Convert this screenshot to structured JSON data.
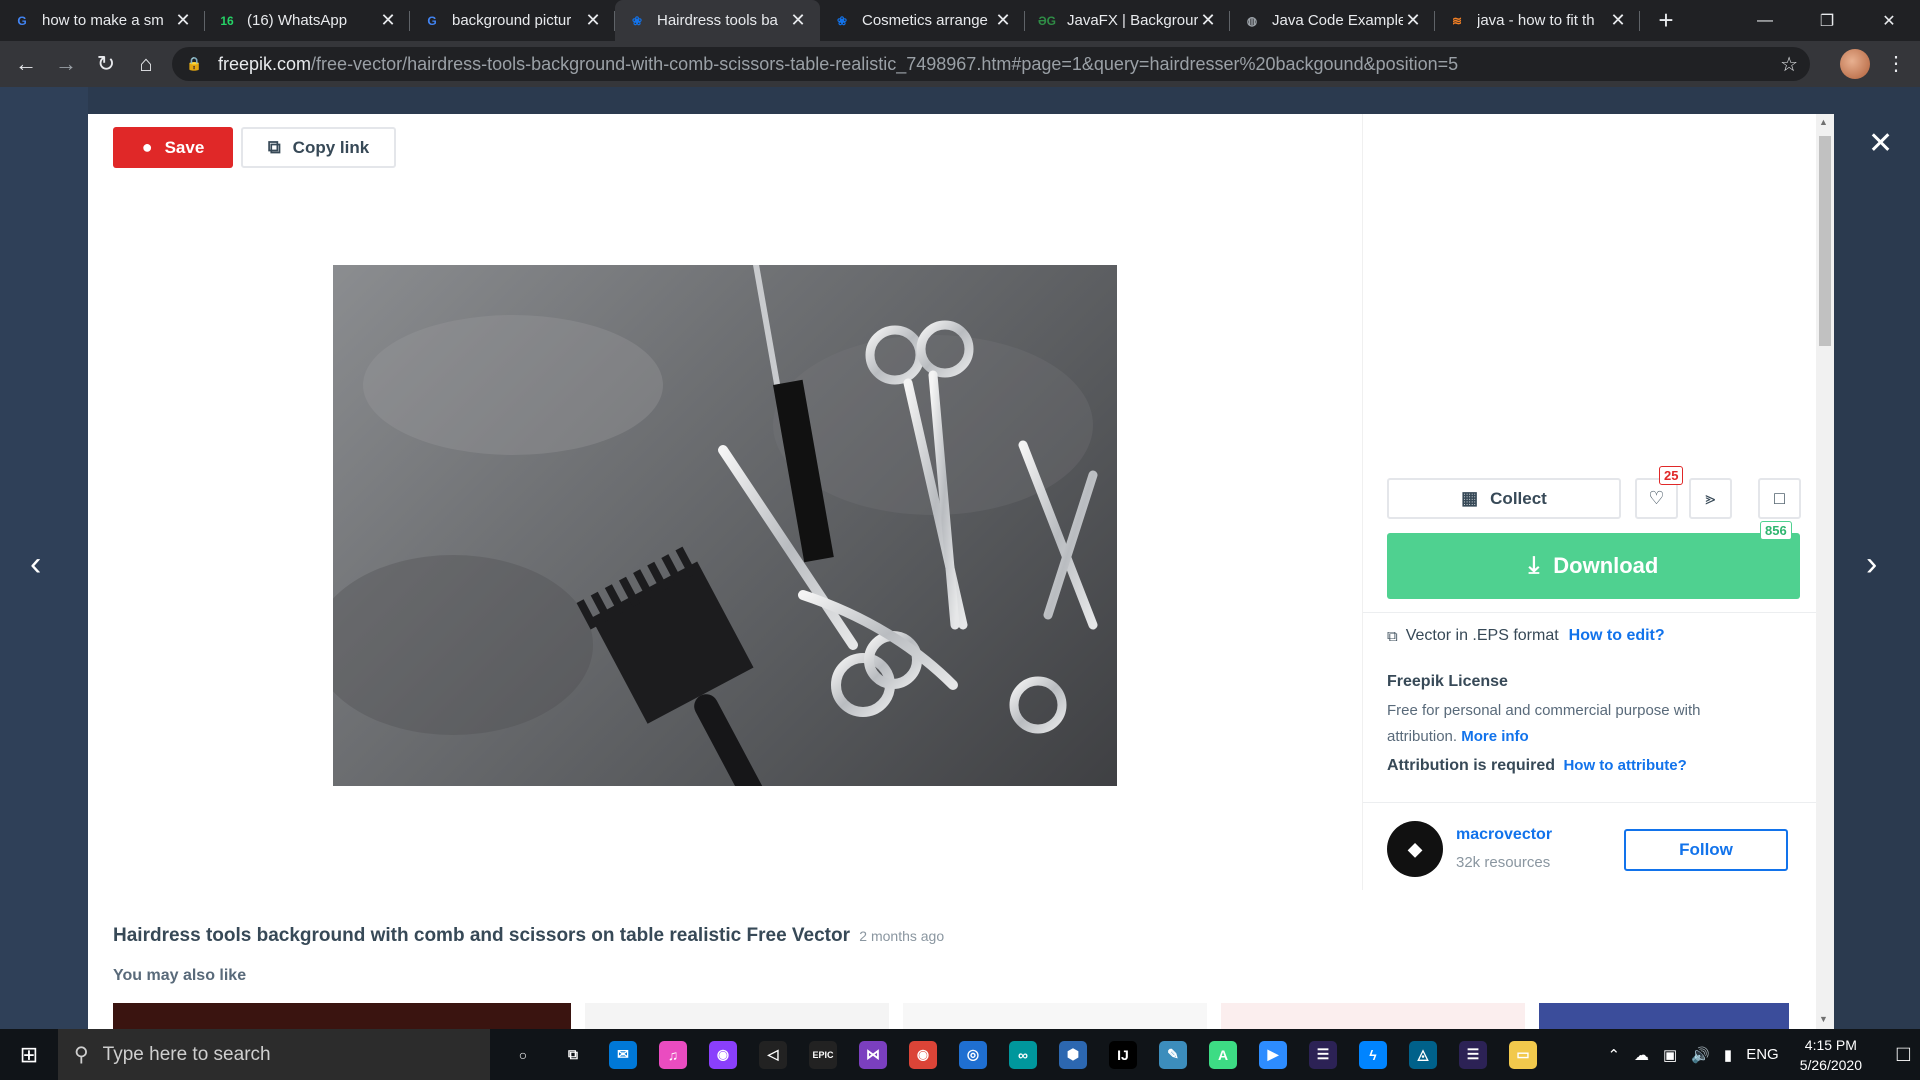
{
  "browser": {
    "tabs": [
      {
        "title": "how to make a sm",
        "icon": "google-icon",
        "color": "#4285f4",
        "glyph": "G",
        "active": false
      },
      {
        "title": "(16) WhatsApp",
        "icon": "whatsapp-icon",
        "color": "#25d366",
        "glyph": "16",
        "active": false
      },
      {
        "title": "background pictur",
        "icon": "google-icon",
        "color": "#4285f4",
        "glyph": "G",
        "active": false
      },
      {
        "title": "Hairdress tools ba",
        "icon": "freepik-icon",
        "color": "#1273eb",
        "glyph": "❀",
        "active": true
      },
      {
        "title": "Cosmetics arrange",
        "icon": "freepik-icon",
        "color": "#1273eb",
        "glyph": "❀",
        "active": false
      },
      {
        "title": "JavaFX | Backgrour",
        "icon": "geeksforgeeks-icon",
        "color": "#2f8d46",
        "glyph": "ƏG",
        "active": false
      },
      {
        "title": "Java Code Example",
        "icon": "globe-icon",
        "color": "#9aa0a6",
        "glyph": "◍",
        "active": false
      },
      {
        "title": "java - how to fit th",
        "icon": "stackoverflow-icon",
        "color": "#f48024",
        "glyph": "≋",
        "active": false
      }
    ],
    "url_host": "freepik.com",
    "url_path": "/free-vector/hairdress-tools-background-with-comb-scissors-table-realistic_7498967.htm#page=1&query=hairdresser%20backgound&position=5"
  },
  "modal": {
    "save_label": "Save",
    "copy_label": "Copy link",
    "collect_label": "Collect",
    "like_count": "25",
    "download_label": "Download",
    "download_count": "856",
    "format_text": "Vector in .EPS format",
    "how_to_edit": "How to edit?",
    "license_title": "Freepik License",
    "license_text": "Free for personal and commercial purpose with attribution.",
    "more_info": "More info",
    "attribution_text": "Attribution is required",
    "how_to_attribute": "How to attribute?",
    "author_name": "macrovector",
    "author_resources": "32k resources",
    "follow_label": "Follow",
    "page_title": "Hairdress tools background with comb and scissors on table realistic Free Vector",
    "posted_ago": "2 months ago",
    "also_like": "You may also like"
  },
  "taskbar": {
    "search_placeholder": "Type here to search",
    "language": "ENG",
    "time": "4:15 PM",
    "date": "5/26/2020",
    "apps": [
      {
        "name": "cortana-icon",
        "color": "transparent",
        "glyph": "○"
      },
      {
        "name": "task-view-icon",
        "color": "transparent",
        "glyph": "⧉"
      },
      {
        "name": "mail-icon",
        "color": "#0078d7",
        "glyph": "✉"
      },
      {
        "name": "itunes-icon",
        "color": "#ea4cc0",
        "glyph": "♫"
      },
      {
        "name": "podcast-icon",
        "color": "#8a3ffc",
        "glyph": "◉"
      },
      {
        "name": "unity-icon",
        "color": "#222",
        "glyph": "◁"
      },
      {
        "name": "epic-games-icon",
        "color": "#222",
        "glyph": "EPIC"
      },
      {
        "name": "visual-studio-icon",
        "color": "#7b3fbf",
        "glyph": "⋈"
      },
      {
        "name": "chrome-icon",
        "color": "#db4437",
        "glyph": "◉"
      },
      {
        "name": "instagram-icon",
        "color": "#1f6fd1",
        "glyph": "◎"
      },
      {
        "name": "arduino-icon",
        "color": "#00979c",
        "glyph": "∞"
      },
      {
        "name": "virtualbox-icon",
        "color": "#2c67b0",
        "glyph": "⬢"
      },
      {
        "name": "intellij-icon",
        "color": "#000",
        "glyph": "IJ"
      },
      {
        "name": "notepad-icon",
        "color": "#3c8dbc",
        "glyph": "✎"
      },
      {
        "name": "android-studio-icon",
        "color": "#3ddc84",
        "glyph": "A"
      },
      {
        "name": "zoom-icon",
        "color": "#2d8cff",
        "glyph": "▶"
      },
      {
        "name": "eclipse-icon",
        "color": "#2c2255",
        "glyph": "☰"
      },
      {
        "name": "messenger-icon",
        "color": "#0084ff",
        "glyph": "ϟ"
      },
      {
        "name": "mysql-icon",
        "color": "#00618a",
        "glyph": "◬"
      },
      {
        "name": "eclipse-2-icon",
        "color": "#2c2255",
        "glyph": "☰"
      },
      {
        "name": "file-explorer-icon",
        "color": "#f2c94c",
        "glyph": "▭"
      }
    ]
  }
}
